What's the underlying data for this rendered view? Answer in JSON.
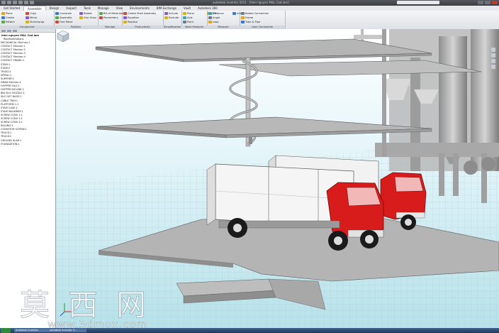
{
  "window": {
    "title": "autodesk inventor 2011 - [hien nguyen M&L Cad.iam]"
  },
  "menu_tabs": [
    "Get Started",
    "Assemble",
    "Design",
    "Inspect",
    "Tools",
    "Manage",
    "View",
    "Environments",
    "BIM Exchange",
    "Vault",
    "Autodesk 360"
  ],
  "ribbon": {
    "panels": [
      {
        "label": "Component",
        "buttons": [
          "Place",
          "Create",
          "Pattern",
          "Copy",
          "Mirror",
          "Shrinkwrap"
        ]
      },
      {
        "label": "Position",
        "buttons": [
          "Constrain",
          "Assemble",
          "Free Move",
          "Rotate",
          "Grip Snap"
        ]
      },
      {
        "label": "Manage",
        "buttons": [
          "Bill of Materials",
          "Parameters"
        ]
      },
      {
        "label": "Productivity",
        "buttons": [
          "Create Shell Assembly",
          "Equation",
          "Replace"
        ]
      },
      {
        "label": "Simplification",
        "buttons": [
          "Include",
          "Exclude"
        ]
      },
      {
        "label": "Work Features",
        "buttons": [
          "Plane",
          "Axis",
          "Point",
          "UCS"
        ]
      },
      {
        "label": "Measure",
        "buttons": [
          "Distance",
          "Angle",
          "Loop",
          "Area"
        ]
      },
      {
        "label": "User Commands",
        "buttons": [
          "Bolted Connection",
          "Frame",
          "Tube & Pipe"
        ]
      }
    ]
  },
  "browser": {
    "title": "hien nguyen M&L Cad.iam",
    "subtitle": "Representations",
    "nodes": [
      "MECHANICAL Mechan:1",
      "CONTACT Mechan:1",
      "CONTACT Mechan:2",
      "CONTACT Mechan:3",
      "CONTACT Mechan:4",
      "CONTACT FRAME:1",
      "STAIR:1",
      "STAIR:2",
      "TRUSS:1",
      "SPIRAL:1",
      "SUPPORT:1",
      "DRAW Mechan:1",
      "HOPPER SILO:1",
      "HOPPER INCLINE:1",
      "BIN SILO NOZZLE:1",
      "SILO 50T BASE:1",
      "CABLE TRAY:1",
      "PLATFORM 1:1",
      "STAIR CASE:1",
      "STAIR WALKWAY:1",
      "SCREW CONV 1:1",
      "SCREW CONV 2:1",
      "SCREW CONV 3:1",
      "RAILING:1",
      "CONVEYOR SCREW:1",
      "TRUCK:1",
      "TRUCK:2",
      "GROUND SLAB:1",
      "FOUNDATION:1"
    ]
  },
  "watermark": {
    "brand": "莫西网",
    "url": "www.3dmox.com"
  },
  "taskbar": {
    "items": [
      "Autodesk Inventor",
      "autodesk inventor 2..."
    ]
  },
  "colors": {
    "truck_cab": "#d81b1b",
    "sky_top": "#ffffff",
    "sky_bottom": "#b7e1e9",
    "ribbon_bg": "#e4e7ec",
    "slab": "#b4b4b4"
  },
  "icons": [
    "viewcube-icon",
    "ucs-triad-icon"
  ]
}
